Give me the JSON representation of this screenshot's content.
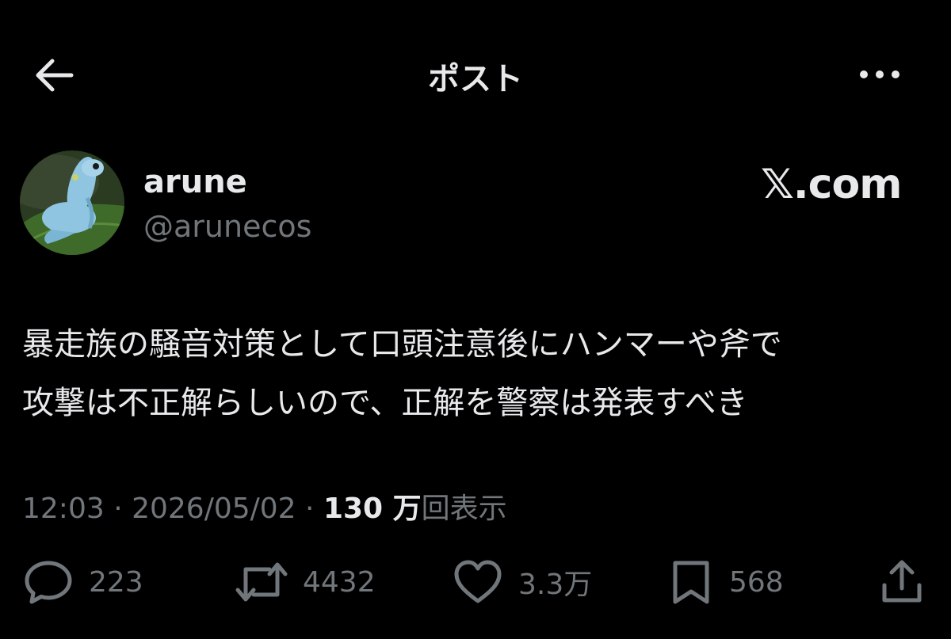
{
  "header": {
    "title": "ポスト",
    "back_icon": "arrow-left-icon",
    "more_icon": "more-horizontal-icon"
  },
  "author": {
    "display_name": "arune",
    "handle": "@arunecos",
    "avatar": "frog-avatar"
  },
  "watermark": "𝕏.com",
  "post": {
    "lines": [
      "暴走族の騒音対策として口頭注意後にハンマーや斧で",
      "攻撃は不正解らしいので、正解を警察は発表すべき"
    ]
  },
  "meta": {
    "time": "12:03",
    "separator": " · ",
    "date": "2026/05/02",
    "views_number": "130 万",
    "views_label": "回表示"
  },
  "actions": {
    "reply": {
      "icon": "reply-icon",
      "count": "223"
    },
    "repost": {
      "icon": "repost-icon",
      "count": "4432"
    },
    "like": {
      "icon": "heart-icon",
      "count": "3.3万"
    },
    "bookmark": {
      "icon": "bookmark-icon",
      "count": "568"
    },
    "share": {
      "icon": "share-icon"
    }
  },
  "colors": {
    "background": "#000000",
    "primary_text": "#e7e9ea",
    "secondary_text": "#71767b",
    "avatar_frog": "#8fc5e0"
  }
}
